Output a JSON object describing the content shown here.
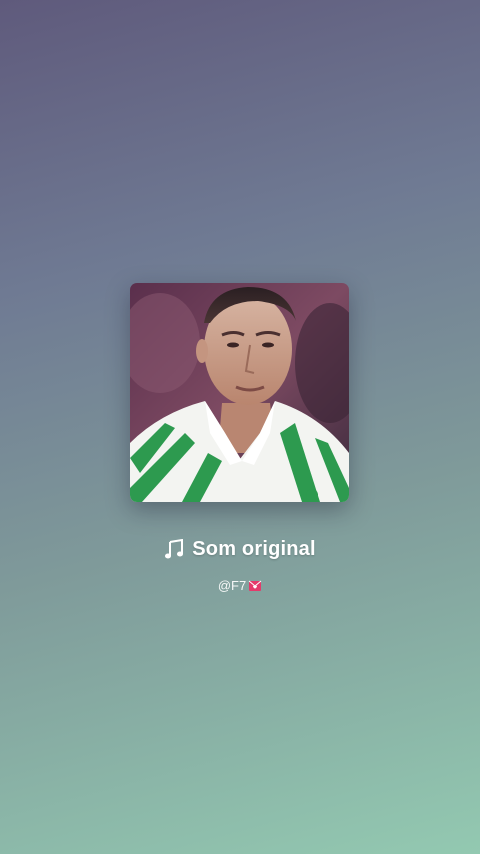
{
  "sound": {
    "cover_icon": "album-cover-image",
    "note_icon": "music-note-icon",
    "title": "Som original",
    "author": "@F7",
    "author_emoji_icon": "heart-letter-emoji-icon"
  },
  "colors": {
    "text": "#ffffff",
    "emoji": "#e43b6b"
  }
}
